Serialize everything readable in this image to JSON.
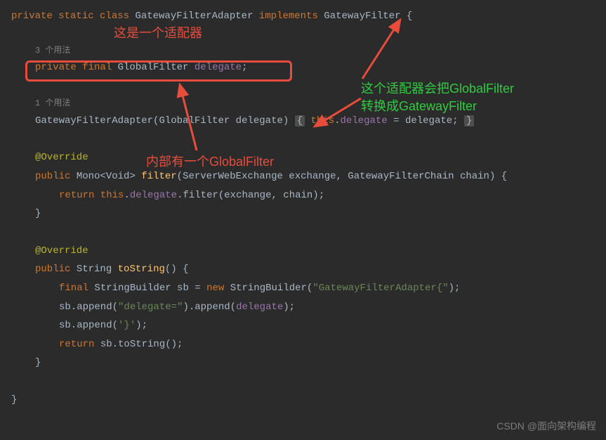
{
  "code": {
    "line1": {
      "kw1": "private static class",
      "name": "GatewayFilterAdapter",
      "kw2": "implements",
      "iface": "GatewayFilter",
      "brace": "{"
    },
    "usages1": "3 个用法",
    "line2": {
      "kw": "private final",
      "type": "GlobalFilter",
      "field": "delegate",
      "semi": ";"
    },
    "usages2": "1 个用法",
    "line3": {
      "ctor": "GatewayFilterAdapter",
      "lp": "(",
      "ptype": "GlobalFilter",
      "pname": "delegate",
      "rp": ")",
      "lbrace": "{",
      "this": "this",
      "dot": ".",
      "field": "delegate",
      "assign": " = delegate; ",
      "rbrace": "}"
    },
    "override1": "@Override",
    "line4": {
      "kw": "public",
      "rtype": "Mono<Void>",
      "method": "filter",
      "params": "(ServerWebExchange exchange, GatewayFilterChain chain) {"
    },
    "line5": {
      "kw": "return",
      "this": "this",
      "dot1": ".",
      "field": "delegate",
      "dot2": ".",
      "call": "filter(exchange, chain);"
    },
    "closebrace1": "}",
    "override2": "@Override",
    "line6": {
      "kw": "public",
      "rtype": "String",
      "method": "toString",
      "params": "() {"
    },
    "line7": {
      "kw": "final",
      "type": "StringBuilder",
      "var": "sb",
      "eq": " = ",
      "new": "new",
      "ctor": "StringBuilder(",
      "str": "\"GatewayFilterAdapter{\"",
      "end": ");"
    },
    "line8": {
      "pre": "sb.append(",
      "str": "\"delegate=\"",
      "mid": ").append(",
      "field": "delegate",
      "end": ");"
    },
    "line9": {
      "pre": "sb.append(",
      "char": "'}'",
      "end": ");"
    },
    "line10": {
      "kw": "return",
      "rest": " sb.toString();"
    },
    "closebrace2": "}",
    "closebrace3": "}"
  },
  "annotations": {
    "red1": "这是一个适配器",
    "red2": "内部有一个GlobalFilter",
    "green1": "这个适配器会把GlobalFilter",
    "green2": "转换成GatewayFilter"
  },
  "watermark": "CSDN @面向架构编程"
}
